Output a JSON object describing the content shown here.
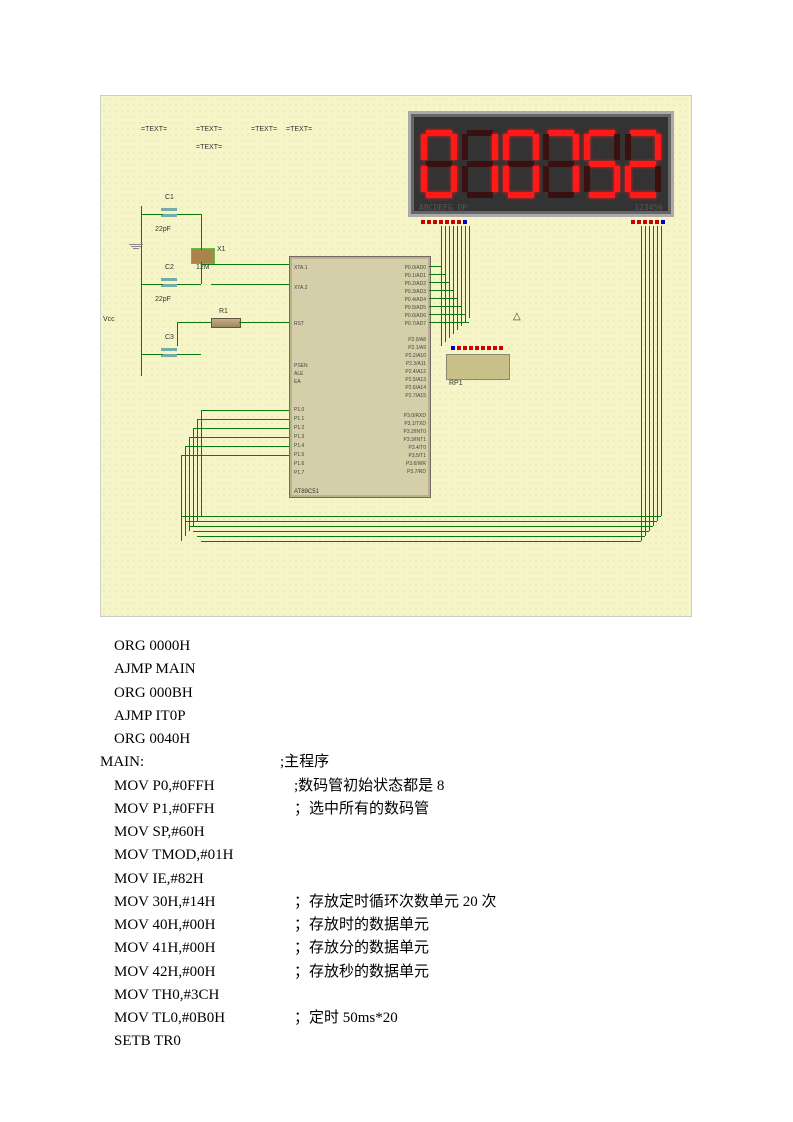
{
  "schematic": {
    "display_digits": "010752",
    "display_label_left": "ABCDEFG DP",
    "display_label_right": "123456",
    "mcu_name": "AT89C51",
    "mcu_pins_left_upper": [
      "XTA.1",
      "XTA.2"
    ],
    "mcu_pins_rst": "RST",
    "mcu_pins_ctrl": [
      "PSEN",
      "ALE",
      "EA"
    ],
    "mcu_pins_p1": [
      "P1.0",
      "P1.1",
      "P1.2",
      "P1.3",
      "P1.4",
      "P1.5",
      "P1.6",
      "P1.7"
    ],
    "mcu_pins_p0": [
      "P0.0/AD0",
      "P0.1/AD1",
      "P0.2/AD2",
      "P0.3/AD3",
      "P0.4/AD4",
      "P0.5/AD5",
      "P0.6/AD6",
      "P0.7/AD7"
    ],
    "mcu_pins_p2": [
      "P2.0/A8",
      "P2.1/A9",
      "P2.2/A10",
      "P2.3/A11",
      "P2.4/A12",
      "P2.5/A13",
      "P2.6/A14",
      "P2.7/A15"
    ],
    "mcu_pins_p3": [
      "P3.0/RXD",
      "P3.1/TXD",
      "P3.2/INT0",
      "P3.3/INT1",
      "P3.4/T0",
      "P3.5/T1",
      "P3.6/WR",
      "P3.7/RD"
    ],
    "components": {
      "c1": "C1",
      "c2": "C2",
      "c3": "C3",
      "x1": "X1",
      "x1v": "12M",
      "r1": "R1",
      "rp1": "RP1",
      "cap22": "22pF",
      "vcc": "Vcc"
    },
    "text_nodes": [
      "=TEXT=",
      "=TEXT=",
      "=TEXT=",
      "=TEXT=",
      "=TEXT="
    ],
    "delta": "△"
  },
  "code": [
    {
      "i": "ORG 0000H",
      "c": ""
    },
    {
      "i": "AJMP MAIN",
      "c": ""
    },
    {
      "i": "ORG 000BH",
      "c": ""
    },
    {
      "i": "AJMP IT0P",
      "c": ""
    },
    {
      "i": "ORG 0040H",
      "c": ""
    },
    {
      "i": "MAIN:",
      "c": ";主程序",
      "label": true
    },
    {
      "i": "MOV P0,#0FFH",
      "c": ";数码管初始状态都是 8"
    },
    {
      "i": "MOV P1,#0FFH",
      "c": "；选中所有的数码管"
    },
    {
      "i": "MOV SP,#60H",
      "c": ""
    },
    {
      "i": "MOV TMOD,#01H",
      "c": ""
    },
    {
      "i": "MOV IE,#82H",
      "c": ""
    },
    {
      "i": "MOV 30H,#14H",
      "c": "；存放定时循环次数单元 20 次"
    },
    {
      "i": "MOV 40H,#00H",
      "c": "；存放时的数据单元"
    },
    {
      "i": "MOV 41H,#00H",
      "c": "；存放分的数据单元"
    },
    {
      "i": "MOV 42H,#00H",
      "c": "；存放秒的数据单元"
    },
    {
      "i": "MOV TH0,#3CH",
      "c": ""
    },
    {
      "i": "MOV TL0,#0B0H",
      "c": "；定时 50ms*20"
    },
    {
      "i": "SETB TR0",
      "c": ""
    }
  ]
}
